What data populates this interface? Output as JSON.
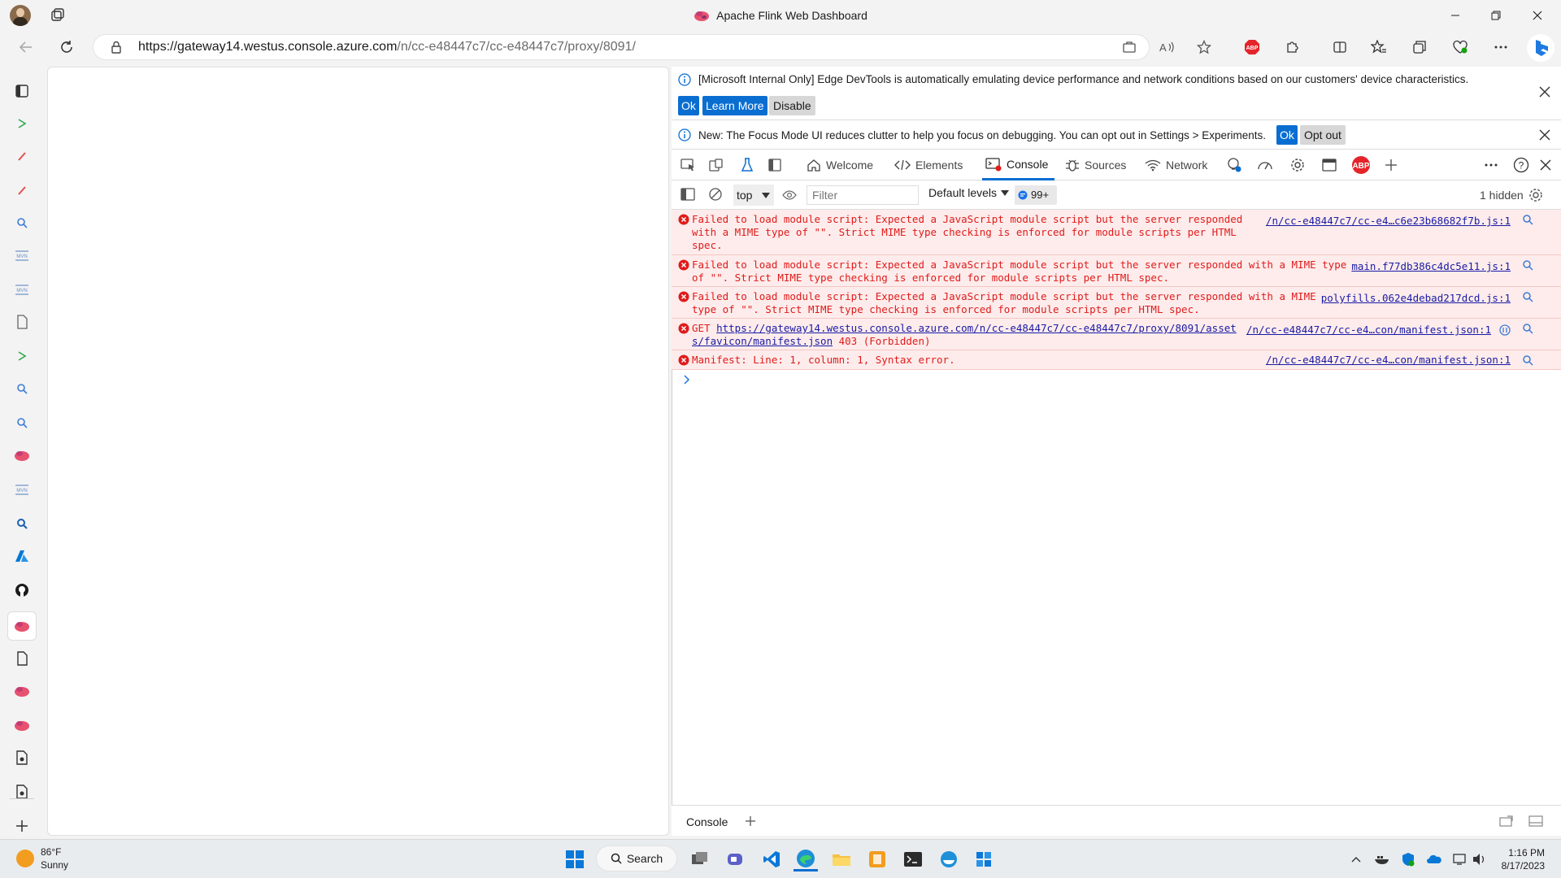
{
  "window": {
    "title": "Apache Flink Web Dashboard"
  },
  "address": {
    "domain": "https://gateway14.westus.console.azure.com",
    "path": "/n/cc-e48447c7/cc-e48447c7/proxy/8091/"
  },
  "toolbar": {
    "abp_label": "ABP"
  },
  "devtools": {
    "info1": {
      "text": "[Microsoft Internal Only] Edge DevTools is automatically emulating device performance and network conditions based on our customers' device characteristics.",
      "ok": "Ok",
      "learn_more": "Learn More",
      "disable": "Disable"
    },
    "info2": {
      "text": "New: The Focus Mode UI reduces clutter to help you focus on debugging. You can opt out in Settings > Experiments.",
      "ok": "Ok",
      "opt_out": "Opt out"
    },
    "tabs": {
      "welcome": "Welcome",
      "elements": "Elements",
      "console": "Console",
      "sources": "Sources",
      "network": "Network",
      "abp": "ABP"
    },
    "console_toolbar": {
      "context": "top",
      "filter_placeholder": "Filter",
      "levels": "Default levels",
      "issues": "99+",
      "hidden": "1 hidden"
    },
    "messages": [
      {
        "lines": [
          "Failed to load module script: Expected a JavaScript module script but the server responded",
          "with a MIME type of \"\". Strict MIME type checking is enforced for module scripts per HTML",
          "spec."
        ],
        "source": "/n/cc-e48447c7/cc-e4…c6e23b68682f7b.js:1"
      },
      {
        "lines": [
          "Failed to load module script: Expected a JavaScript module script but the server responded with a MIME type",
          "of \"\". Strict MIME type checking is enforced for module scripts per HTML spec."
        ],
        "source": "main.f77db386c4dc5e11.js:1"
      },
      {
        "lines": [
          "Failed to load module script: Expected a JavaScript module script but the server responded with a MIME",
          "type of \"\". Strict MIME type checking is enforced for module scripts per HTML spec."
        ],
        "source": "polyfills.062e4debad217dcd.js:1"
      },
      {
        "get": "GET",
        "link1": "https://gateway14.westus.console.azure.com/n/cc-e48447c7/cc-e48447c7/proxy/8091/asset",
        "link2": "s/favicon/manifest.json",
        "status": "403 (Forbidden)",
        "source": "/n/cc-e48447c7/cc-e4…con/manifest.json:1"
      },
      {
        "lines": [
          "Manifest: Line: 1, column: 1, Syntax error."
        ],
        "source": "/n/cc-e48447c7/cc-e4…con/manifest.json:1"
      }
    ],
    "drawer_tab": "Console"
  },
  "taskbar": {
    "temperature": "86°F",
    "condition": "Sunny",
    "search": "Search",
    "time": "1:16 PM",
    "date": "8/17/2023"
  }
}
